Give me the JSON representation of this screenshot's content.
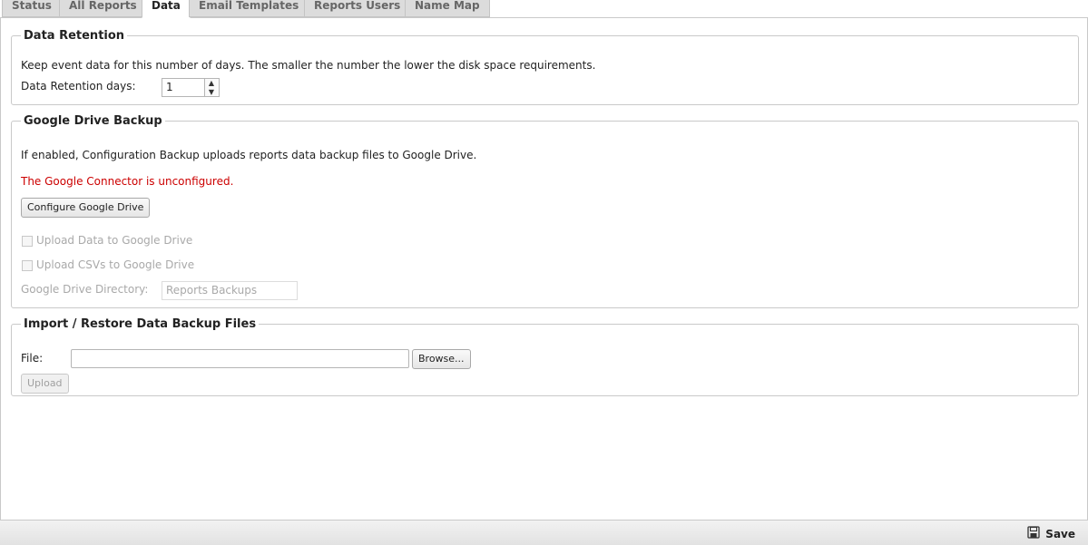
{
  "tabs": [
    {
      "label": "Status"
    },
    {
      "label": "All Reports"
    },
    {
      "label": "Data",
      "active": true
    },
    {
      "label": "Email Templates"
    },
    {
      "label": "Reports Users"
    },
    {
      "label": "Name Map"
    }
  ],
  "retention": {
    "legend": "Data Retention",
    "description": "Keep event data for this number of days. The smaller the number the lower the disk space requirements.",
    "days_label": "Data Retention days:",
    "days_value": "1"
  },
  "gdrive": {
    "legend": "Google Drive Backup",
    "description": "If enabled, Configuration Backup uploads reports data backup files to Google Drive.",
    "warning": "The Google Connector is unconfigured.",
    "configure_button": "Configure Google Drive",
    "upload_data_label": "Upload Data to Google Drive",
    "upload_csv_label": "Upload CSVs to Google Drive",
    "directory_label": "Google Drive Directory:",
    "directory_value": "Reports Backups"
  },
  "import": {
    "legend": "Import / Restore Data Backup Files",
    "file_label": "File:",
    "file_value": "",
    "browse_button": "Browse...",
    "upload_button": "Upload"
  },
  "footer": {
    "save_label": "Save",
    "save_icon": "floppy-disk-icon"
  },
  "colors": {
    "warning": "#cc0000"
  }
}
